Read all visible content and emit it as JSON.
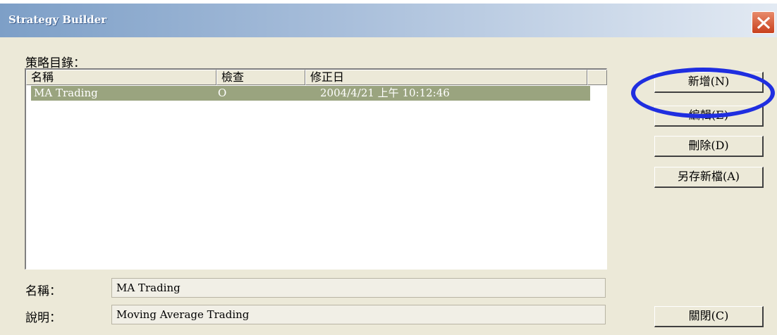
{
  "window": {
    "title": "Strategy Builder"
  },
  "strategy_list": {
    "caption": "策略目錄：",
    "columns": [
      "名稱",
      "檢查",
      "修正日"
    ],
    "rows": [
      {
        "name": "MA Trading",
        "check": "O",
        "modified": "2004/4/21 上午 10:12:46",
        "selected": true
      }
    ]
  },
  "details": {
    "name_label": "名稱：",
    "name_value": "MA Trading",
    "description_label": "說明：",
    "description_value": "Moving Average Trading"
  },
  "buttons": {
    "new": "新增(N)",
    "edit": "編輯(E)",
    "delete": "刪除(D)",
    "save_as": "另存新檔(A)",
    "close": "關閉(C)"
  },
  "colors": {
    "selection": "#9aa47f",
    "annotation_circle": "#1f2ee0",
    "close_button": "#c8401e"
  },
  "icons": {
    "close": "close-x-icon"
  }
}
